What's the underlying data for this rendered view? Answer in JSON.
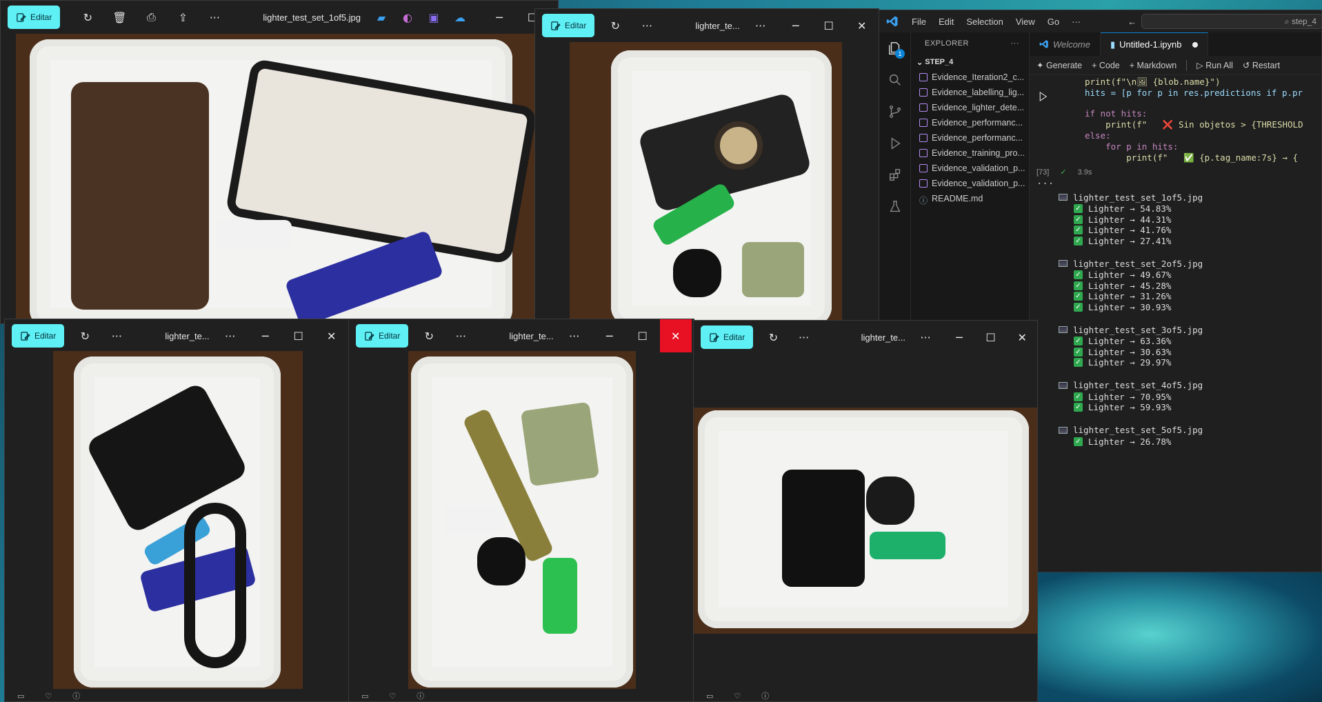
{
  "viewer": {
    "edit_label": "Editar",
    "more": "···",
    "min": "─",
    "max": "☐",
    "close": "✕"
  },
  "windows": {
    "w1": {
      "title": "lighter_test_set_1of5.jpg"
    },
    "w2": {
      "title": "lighter_te..."
    },
    "w3": {
      "title": "lighter_te..."
    },
    "w4": {
      "title": "lighter_te..."
    },
    "w5": {
      "title": "lighter_te..."
    }
  },
  "vscode": {
    "menu": [
      "File",
      "Edit",
      "Selection",
      "View",
      "Go",
      "···"
    ],
    "search_text": "step_4",
    "explorer_label": "EXPLORER",
    "explorer_more": "···",
    "section": "STEP_4",
    "files": [
      "Evidence_Iteration2_c...",
      "Evidence_labelling_lig...",
      "Evidence_lighter_dete...",
      "Evidence_performanc...",
      "Evidence_performanc...",
      "Evidence_training_pro...",
      "Evidence_validation_p...",
      "Evidence_validation_p..."
    ],
    "readme": "README.md",
    "badge": "1",
    "tabs": {
      "welcome": "Welcome",
      "notebook": "Untitled-1.ipynb"
    },
    "toolbar": {
      "generate": "Generate",
      "code": "+ Code",
      "markdown": "+ Markdown",
      "run_all": "Run All",
      "restart": "Restart"
    },
    "code": {
      "l1": "print(f\"\\n🖼 {blob.name}\")",
      "l2": "hits = [p for p in res.predictions if p.pr",
      "l3": "if not hits:",
      "l4": "    print(f\"   ❌ Sin objetos > {THRESHOLD",
      "l5": "else:",
      "l6": "    for p in hits:",
      "l7": "        print(f\"   ✅ {p.tag_name:7s} → {"
    },
    "cell_index": "[73]",
    "cell_time": "3.9s",
    "more_dots": "···",
    "output": [
      {
        "file": "lighter_test_set_1of5.jpg",
        "hits": [
          "Lighter → 54.83%",
          "Lighter → 44.31%",
          "Lighter → 41.76%",
          "Lighter → 27.41%"
        ]
      },
      {
        "file": "lighter_test_set_2of5.jpg",
        "hits": [
          "Lighter → 49.67%",
          "Lighter → 45.28%",
          "Lighter → 31.26%",
          "Lighter → 30.93%"
        ]
      },
      {
        "file": "lighter_test_set_3of5.jpg",
        "hits": [
          "Lighter → 63.36%",
          "Lighter → 30.63%",
          "Lighter → 29.97%"
        ]
      },
      {
        "file": "lighter_test_set_4of5.jpg",
        "hits": [
          "Lighter → 70.95%",
          "Lighter → 59.93%"
        ]
      },
      {
        "file": "lighter_test_set_5of5.jpg",
        "hits": [
          "Lighter → 26.78%"
        ]
      }
    ]
  },
  "colors": {
    "accent": "#5ef0f5",
    "close_red": "#e81123",
    "vscode_blue": "#0a84d6",
    "check_green": "#2fa84f"
  }
}
